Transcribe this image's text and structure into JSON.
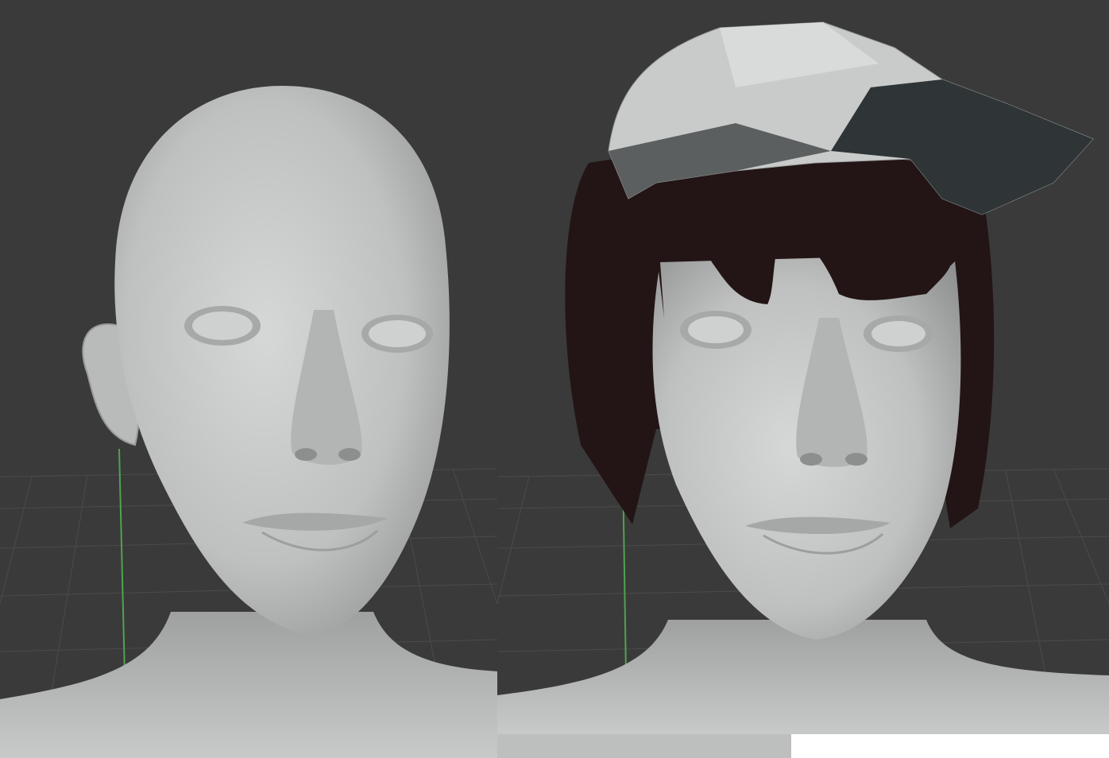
{
  "viewports": [
    {
      "id": "left",
      "label": "",
      "content": "bald-head-model",
      "icons": [
        "head-icon",
        "y-axis-line-icon"
      ]
    },
    {
      "id": "right",
      "label": "",
      "content": "head-model-with-hair-and-cap",
      "icons": [
        "head-icon",
        "hair-icon",
        "cap-icon",
        "y-axis-line-icon"
      ]
    }
  ],
  "colors": {
    "viewport_background": "#3a3a3a",
    "grid_line": "#4a4a4a",
    "skin": "#c4c5c5",
    "hair": "#231515",
    "cap_light": "#c9cbcb",
    "cap_dark": "#2f3536",
    "axis_green": "#4fa34f"
  }
}
